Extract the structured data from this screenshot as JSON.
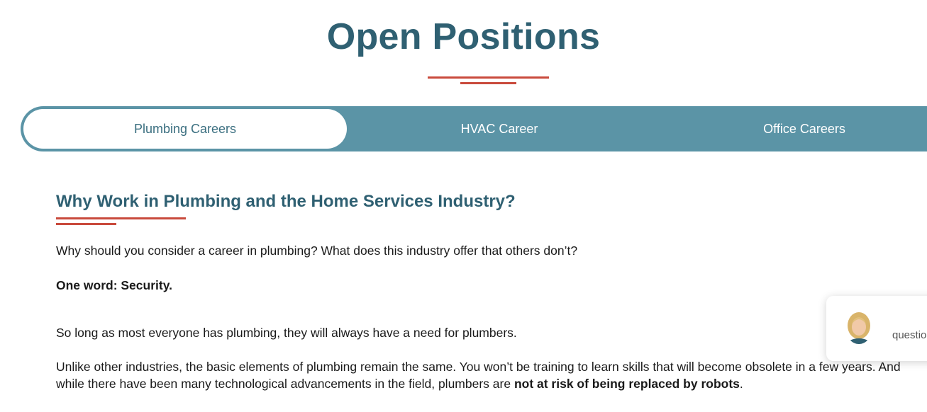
{
  "page": {
    "title": "Open Positions"
  },
  "tabs": [
    {
      "label": "Plumbing Careers",
      "active": true
    },
    {
      "label": "HVAC Career",
      "active": false
    },
    {
      "label": "Office Careers",
      "active": false
    }
  ],
  "content": {
    "heading": "Why Work in Plumbing and the Home Services Industry?",
    "p1": "Why should you consider a career in plumbing? What does this industry offer that others don’t?",
    "p2_bold": "One word: Security.",
    "p3": "So long as most everyone has plumbing, they will always have a need for plumbers.",
    "p4_text": "Unlike other industries, the basic elements of plumbing remain the same. You won’t be training to learn skills that will become obsolete in a few years. And while there have been many technological advancements in the field, plumbers are ",
    "p4_bold": "not at risk of being replaced by robots",
    "p4_end": "."
  },
  "chat": {
    "text": "questio"
  },
  "colors": {
    "title": "#2f6072",
    "accent_red": "#c94a3c",
    "tab_bar": "#5b94a6",
    "active_tab_text": "#3b6f80"
  }
}
